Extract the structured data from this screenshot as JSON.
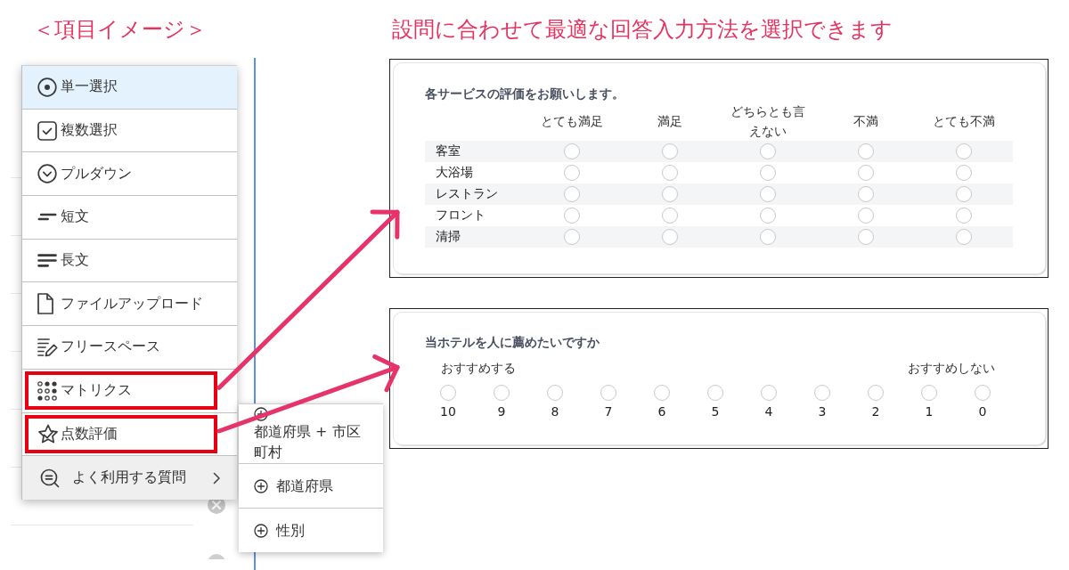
{
  "items_title": "＜項目イメージ＞",
  "headline": "設問に合わせて最適な回答入力方法を選択できます",
  "menu": {
    "items": [
      {
        "kind": "single_choice",
        "label": "単一選択",
        "selected": true,
        "highlighted": false,
        "expanded": false
      },
      {
        "kind": "multiple_choice",
        "label": "複数選択",
        "selected": false,
        "highlighted": false,
        "expanded": false
      },
      {
        "kind": "dropdown",
        "label": "プルダウン",
        "selected": false,
        "highlighted": false,
        "expanded": false
      },
      {
        "kind": "short_text",
        "label": "短文",
        "selected": false,
        "highlighted": false,
        "expanded": false
      },
      {
        "kind": "long_text",
        "label": "長文",
        "selected": false,
        "highlighted": false,
        "expanded": false
      },
      {
        "kind": "file_upload",
        "label": "ファイルアップロード",
        "selected": false,
        "highlighted": false,
        "expanded": false
      },
      {
        "kind": "free_space",
        "label": "フリースペース",
        "selected": false,
        "highlighted": false,
        "expanded": false
      },
      {
        "kind": "matrix",
        "label": "マトリクス",
        "selected": false,
        "highlighted": true,
        "expanded": false
      },
      {
        "kind": "rating",
        "label": "点数評価",
        "selected": false,
        "highlighted": true,
        "expanded": false
      },
      {
        "kind": "submenu",
        "label": "よく利用する質問",
        "selected": false,
        "highlighted": false,
        "expanded": true,
        "submenu_items": [
          {
            "label": "都道府県 + 市区町村"
          },
          {
            "label": "都道府県"
          },
          {
            "label": "性別"
          }
        ]
      }
    ]
  },
  "previews": [
    {
      "kind": "matrix",
      "question": "各サービスの評価をお願いします。",
      "columns": [
        "とても満足",
        "満足",
        "どちらとも言えない",
        "不満",
        "とても不満"
      ],
      "rows": [
        {
          "label": "客室",
          "cells": [
            {
              "selected": false
            },
            {
              "selected": false
            },
            {
              "selected": false
            },
            {
              "selected": false
            },
            {
              "selected": false
            }
          ]
        },
        {
          "label": "大浴場",
          "cells": [
            {
              "selected": false
            },
            {
              "selected": false
            },
            {
              "selected": false
            },
            {
              "selected": false
            },
            {
              "selected": false
            }
          ]
        },
        {
          "label": "レストラン",
          "cells": [
            {
              "selected": false
            },
            {
              "selected": false
            },
            {
              "selected": false
            },
            {
              "selected": false
            },
            {
              "selected": false
            }
          ]
        },
        {
          "label": "フロント",
          "cells": [
            {
              "selected": false
            },
            {
              "selected": false
            },
            {
              "selected": false
            },
            {
              "selected": false
            },
            {
              "selected": false
            }
          ]
        },
        {
          "label": "清掃",
          "cells": [
            {
              "selected": false
            },
            {
              "selected": false
            },
            {
              "selected": false
            },
            {
              "selected": false
            },
            {
              "selected": false
            }
          ]
        }
      ]
    },
    {
      "kind": "scale",
      "question": "当ホテルを人に薦めたいですか",
      "start_label": "おすすめする",
      "end_label": "おすすめしない",
      "points": [
        {
          "label": "10",
          "selected": false
        },
        {
          "label": "9",
          "selected": false
        },
        {
          "label": "8",
          "selected": false
        },
        {
          "label": "7",
          "selected": false
        },
        {
          "label": "6",
          "selected": false
        },
        {
          "label": "5",
          "selected": false
        },
        {
          "label": "4",
          "selected": false
        },
        {
          "label": "3",
          "selected": false
        },
        {
          "label": "2",
          "selected": false
        },
        {
          "label": "1",
          "selected": false
        },
        {
          "label": "0",
          "selected": false
        }
      ]
    }
  ]
}
